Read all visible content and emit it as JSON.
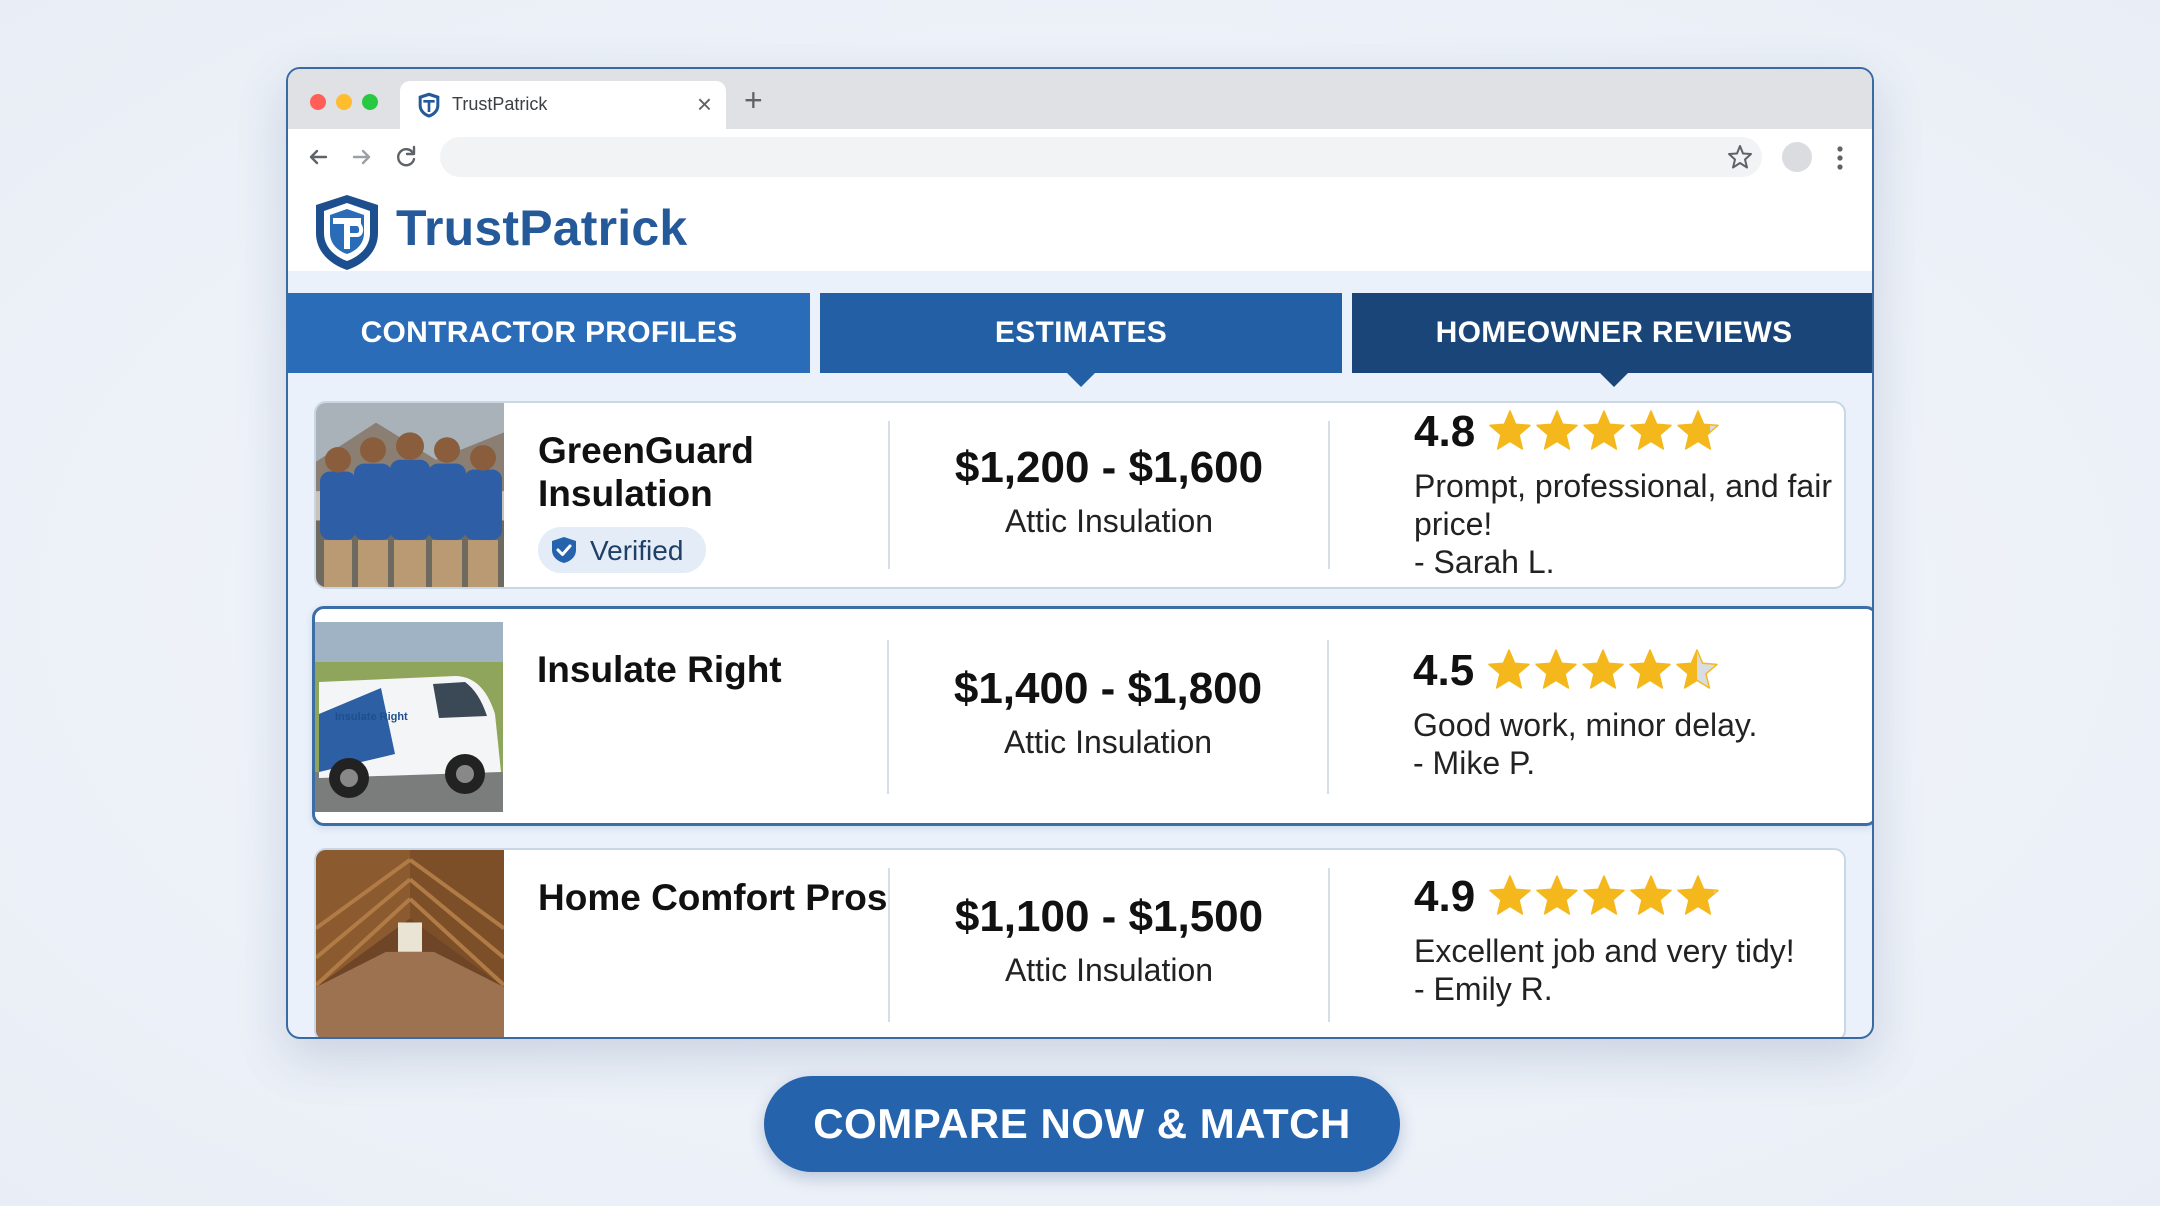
{
  "browser": {
    "tab_title": "TrustPatrick",
    "tab_close": "×",
    "new_tab": "+",
    "address": ""
  },
  "site": {
    "brand": "TrustPatrick",
    "logo_letters": "TP"
  },
  "nav_tabs": [
    {
      "label": "CONTRACTOR PROFILES",
      "color": "#2a6cb7"
    },
    {
      "label": "ESTIMATES",
      "color": "#225fa4"
    },
    {
      "label": "HOMEOWNER REVIEWS",
      "color": "#1a4578"
    }
  ],
  "contractors": [
    {
      "name": "GreenGuard Insulation",
      "verified_label": "Verified",
      "photo": "team-photo",
      "price": "$1,200 - $1,600",
      "service": "Attic Insulation",
      "rating": "4.8",
      "stars": 4.8,
      "review": "Prompt, professional, and fair price!",
      "reviewer": "- Sarah L."
    },
    {
      "name": "Insulate Right",
      "photo": "van-photo",
      "van_text": "Insulate Right",
      "price": "$1,400 - $1,800",
      "service": "Attic Insulation",
      "rating": "4.5",
      "stars": 4.5,
      "review": "Good work, minor delay.",
      "reviewer": "- Mike P."
    },
    {
      "name": "Home Comfort Pros",
      "photo": "attic-photo",
      "price": "$1,100 - $1,500",
      "service": "Attic Insulation",
      "rating": "4.9",
      "stars": 4.9,
      "review": "Excellent job and very tidy!",
      "reviewer": "- Emily R."
    }
  ],
  "cta": {
    "label": "COMPARE NOW & MATCH"
  },
  "colors": {
    "brand": "#24599a",
    "star": "#f5b81c",
    "cta": "#2563ad"
  }
}
